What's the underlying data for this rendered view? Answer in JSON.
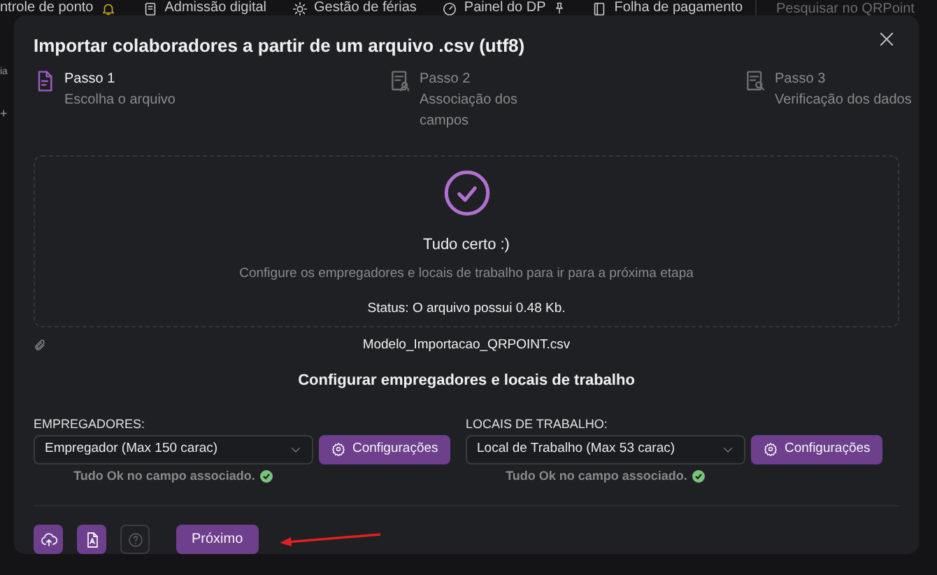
{
  "nav": {
    "items": [
      {
        "label": "ntrole de ponto"
      },
      {
        "label": "Admissão digital"
      },
      {
        "label": "Gestão de férias"
      },
      {
        "label": "Painel do DP"
      },
      {
        "label": "Folha de pagamento"
      }
    ],
    "search": {
      "placeholder": "Pesquisar no QRPoint"
    }
  },
  "background_fragments": [
    "ia",
    "+"
  ],
  "modal": {
    "title": "Importar colaboradores a partir de um arquivo .csv (utf8)",
    "steps": [
      {
        "title": "Passo 1",
        "subtitle": "Escolha o arquivo",
        "selected": true
      },
      {
        "title": "Passo 2",
        "subtitle": "Associação dos campos",
        "selected": false
      },
      {
        "title": "Passo 3",
        "subtitle": "Verificação dos dados",
        "selected": false
      }
    ],
    "upload": {
      "heading": "Tudo certo :)",
      "hint": "Configure os empregadores e locais de trabalho para ir para a próxima etapa",
      "status": "Status: O arquivo possui 0.48 Kb.",
      "file_name": "Modelo_Importacao_QRPOINT.csv"
    },
    "config_heading": "Configurar empregadores e locais de trabalho",
    "fields": [
      {
        "label": "EMPREGADORES:",
        "value": "Empregador (Max 150 carac)",
        "button": "Configurações",
        "message": "Tudo Ok no campo associado.",
        "ok": true
      },
      {
        "label": "LOCAIS DE TRABALHO:",
        "value": "Local de Trabalho (Max 53 carac)",
        "button": "Configurações",
        "message": "Tudo Ok no campo associado.",
        "ok": true
      }
    ],
    "footer": {
      "tools": [
        {
          "kind": "upload",
          "disabled": false
        },
        {
          "kind": "pdf",
          "disabled": false
        },
        {
          "kind": "help",
          "disabled": true
        }
      ],
      "next": "Próximo"
    }
  }
}
